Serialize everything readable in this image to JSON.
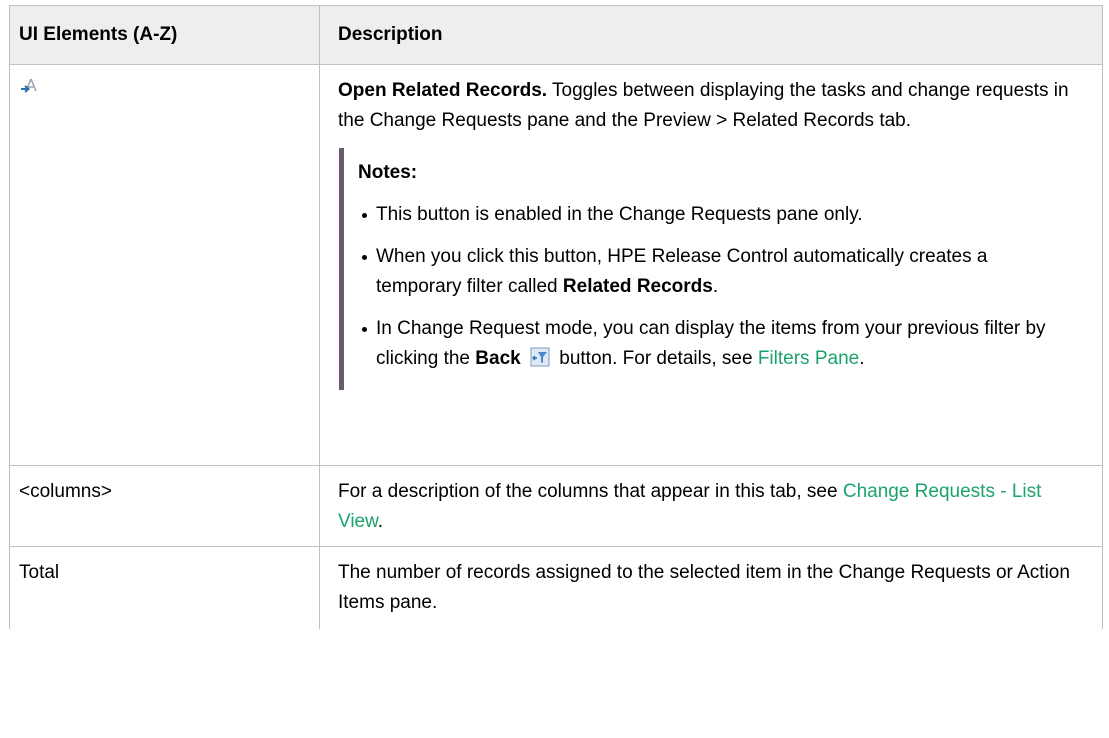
{
  "table": {
    "headers": [
      "UI Elements (A-Z)",
      "Description"
    ],
    "rows": {
      "related": {
        "icon": "open-related-records-icon",
        "title": "Open Related Records.",
        "text": " Toggles between displaying the tasks and change requests in the Change Requests pane and the Preview > Related Records tab.",
        "notes": {
          "title": "Notes:",
          "item1": "This button is enabled in the Change Requests pane only.",
          "item2_pre": "When you click this button, HPE Release Control automatically creates a temporary filter called ",
          "item2_bold": "Related Records",
          "item2_post": ".",
          "item3_pre": "In Change Request mode, you can display the items from your previous filter by clicking the ",
          "item3_bold": "Back",
          "item3_mid": " button. For details, see ",
          "item3_link": "Filters Pane",
          "item3_post": ".",
          "back_icon": "back-filter-icon"
        }
      },
      "columns": {
        "element": "<columns>",
        "text_pre": "For a description of the columns that appear in this tab, see ",
        "link": "Change Requests - List View",
        "text_post": "."
      },
      "total": {
        "element": "Total",
        "text": "The number of records assigned to the selected item in the Change Requests or Action Items pane."
      }
    }
  },
  "colors": {
    "link": "#1aa36b",
    "header_bg": "#eeeeee",
    "notes_bar": "#6a5a6e"
  }
}
